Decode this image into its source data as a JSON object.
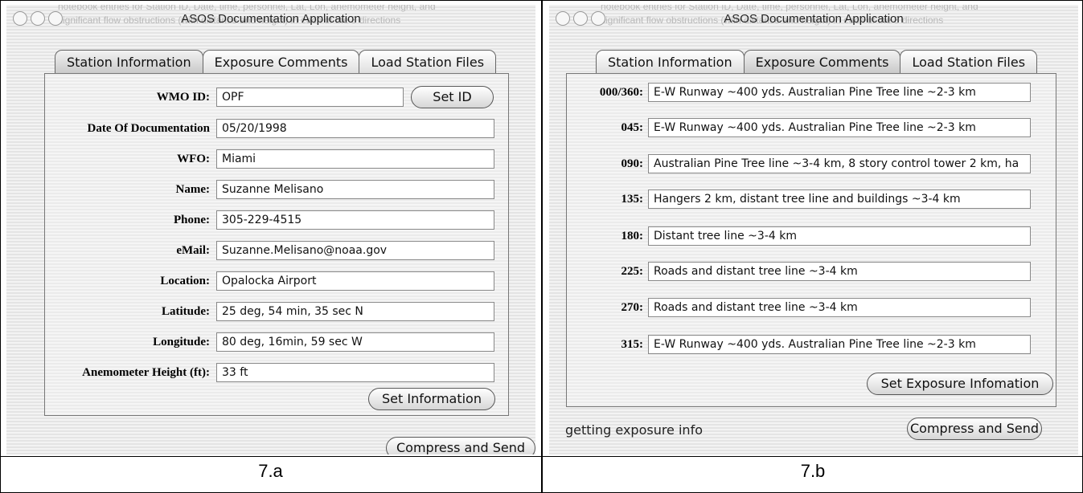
{
  "figure": {
    "label_a": "7.a",
    "label_b": "7.b"
  },
  "app": {
    "title": "ASOS Documentation Application",
    "ghost_line1": "notebook entries for Station ID, Date, time, personnel, Lat, Lon, anemometer height, and",
    "ghost_line2": "significant  flow obstructions (with distance and height) in each of the 8 directions"
  },
  "tabs": [
    "Station Information",
    "Exposure Comments",
    "Load Station Files"
  ],
  "station": {
    "wmo_id_label": "WMO ID:",
    "wmo_id": "OPF",
    "set_id_button": "Set ID",
    "fields": [
      {
        "label": "Date Of Documentation",
        "value": "05/20/1998"
      },
      {
        "label": "WFO:",
        "value": "Miami"
      },
      {
        "label": "Name:",
        "value": "Suzanne Melisano"
      },
      {
        "label": "Phone:",
        "value": "305-229-4515"
      },
      {
        "label": "eMail:",
        "value": "Suzanne.Melisano@noaa.gov"
      },
      {
        "label": "Location:",
        "value": "Opalocka Airport"
      },
      {
        "label": "Latitude:",
        "value": "25 deg, 54 min, 35 sec N"
      },
      {
        "label": "Longitude:",
        "value": "80 deg, 16min, 59 sec W"
      },
      {
        "label": "Anemometer Height (ft):",
        "value": "33 ft"
      }
    ],
    "set_info_button": "Set Information",
    "status": "",
    "compress_button": "Compress and Send"
  },
  "exposure": {
    "rows": [
      {
        "label": "000/360:",
        "value": "E-W Runway ~400 yds. Australian Pine Tree line ~2-3 km"
      },
      {
        "label": "045:",
        "value": "E-W Runway ~400 yds. Australian Pine Tree line ~2-3 km"
      },
      {
        "label": "090:",
        "value": "Australian Pine Tree line ~3-4 km, 8 story control tower 2 km, ha"
      },
      {
        "label": "135:",
        "value": "Hangers 2 km, distant tree line and buildings ~3-4 km"
      },
      {
        "label": "180:",
        "value": "Distant tree line ~3-4 km"
      },
      {
        "label": "225:",
        "value": "Roads and distant tree line ~3-4 km"
      },
      {
        "label": "270:",
        "value": "Roads and distant tree line ~3-4 km"
      },
      {
        "label": "315:",
        "value": "E-W Runway ~400 yds. Australian Pine Tree line ~2-3 km"
      }
    ],
    "set_exposure_button": "Set Exposure Infomation",
    "status": "getting exposure info",
    "compress_button": "Compress and Send"
  }
}
